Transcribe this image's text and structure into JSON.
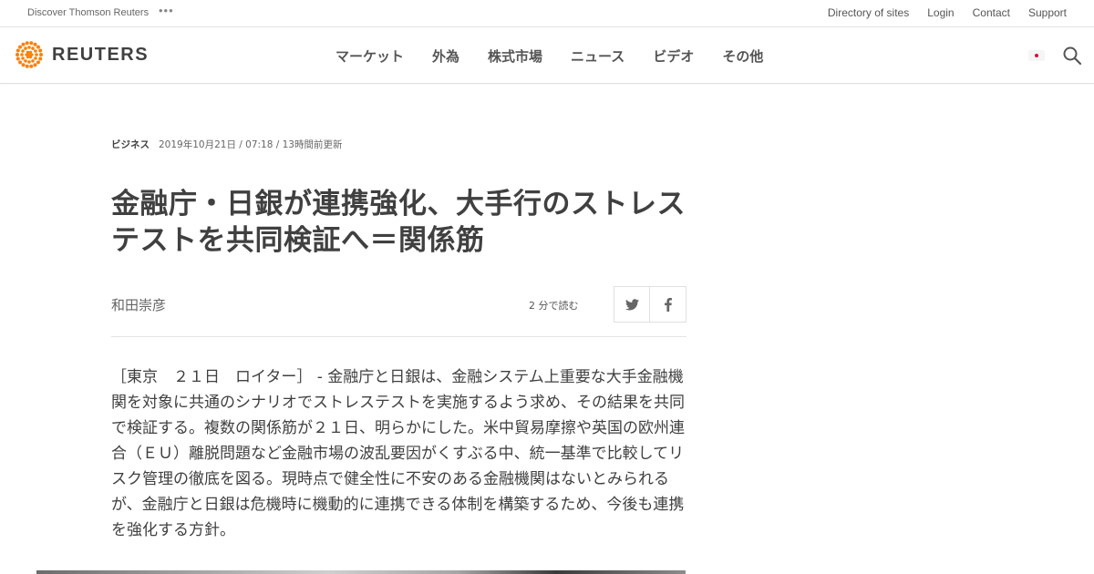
{
  "topbar": {
    "discover": "Discover Thomson Reuters",
    "more": "•••",
    "links": [
      "Directory of sites",
      "Login",
      "Contact",
      "Support"
    ]
  },
  "header": {
    "logo_text": "REUTERS",
    "nav": [
      "マーケット",
      "外為",
      "株式市場",
      "ニュース",
      "ビデオ",
      "その他"
    ],
    "brand_color": "#ff8000"
  },
  "article": {
    "section": "ビジネス",
    "timestamp": "2019年10月21日 / 07:18 / 13時間前更新",
    "headline": "金融庁・日銀が連携強化、大手行のストレステストを共同検証へ＝関係筋",
    "author": "和田崇彦",
    "read_time": "2  分で読む",
    "body": "［東京　２１日　ロイター］ - 金融庁と日銀は、金融システム上重要な大手金融機関を対象に共通のシナリオでストレステストを実施するよう求め、その結果を共同で検証する。複数の関係筋が２１日、明らかにした。米中貿易摩擦や英国の欧州連合（ＥＵ）離脱問題など金融市場の波乱要因がくすぶる中、統一基準で比較してリスク管理の徹底を図る。現時点で健全性に不安のある金融機関はないとみられるが、金融庁と日銀は危機時に機動的に連携できる体制を構築するため、今後も連携を強化する方針。"
  },
  "icons": {
    "search": "search-icon",
    "twitter": "twitter-icon",
    "facebook": "facebook-icon",
    "flag": "japan-flag-icon"
  }
}
